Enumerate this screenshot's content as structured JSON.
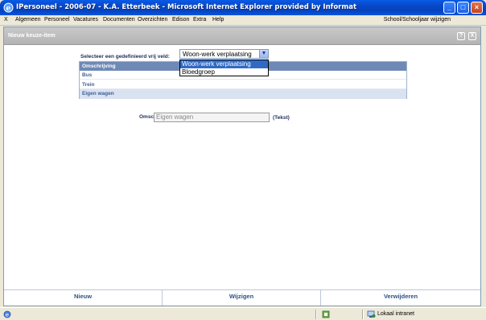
{
  "window": {
    "title": "IPersoneel - 2006-07 - K.A. Etterbeek - Microsoft Internet Explorer provided by Informat",
    "controls": [
      "minimize",
      "maximize",
      "close"
    ]
  },
  "menu": {
    "items": [
      "X",
      "Algemeen",
      "Personeel",
      "Vacatures",
      "Documenten",
      "Overzichten",
      "Edison",
      "Extra",
      "Help"
    ],
    "right": "School/Schooljaar wijzigen"
  },
  "header": {
    "title": "Nieuw keuze-item",
    "help": "?",
    "close": "X"
  },
  "form": {
    "select_label": "Selecteer een gedefinieerd vrij veld:",
    "select_value": "Woon-werk verplaatsing",
    "dropdown_options": [
      "Woon-werk verplaatsing",
      "Bloedgroep"
    ],
    "column_header": "Omschrijving",
    "rows": [
      "Bus",
      "Trein",
      "Eigen wagen"
    ],
    "omschrijving_label": "Omschrijving",
    "omschrijving_value": "Eigen wagen",
    "type_label": "(Tekst)"
  },
  "footer": {
    "new": "Nieuw",
    "edit": "Wijzigen",
    "delete": "Verwijderen"
  },
  "status": {
    "zone": "Lokaal intranet"
  },
  "colors": {
    "titlebar": "#0a5ae8",
    "table_header": "#6f89b6",
    "selected_row": "#d8e2f0",
    "link_text": "#3f5e98",
    "dropdown_highlight": "#316ac5"
  }
}
